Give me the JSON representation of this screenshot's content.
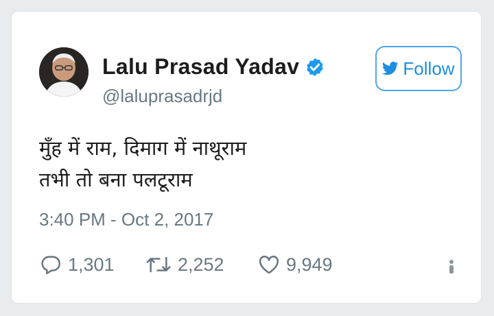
{
  "tweet": {
    "author_name": "Lalu Prasad Yadav",
    "handle": "@laluprasadrjd",
    "verified": true,
    "follow_label": "Follow",
    "text_lines": [
      "मुँह में राम, दिमाग में नाथूराम",
      "तभी तो बना पलटूराम"
    ],
    "timestamp": "3:40 PM - Oct 2, 2017",
    "replies": "1,301",
    "retweets": "2,252",
    "likes": "9,949"
  },
  "icons": {
    "verified": "verified-badge-icon",
    "follow": "twitter-bird-icon",
    "reply": "reply-icon",
    "retweet": "retweet-icon",
    "like": "heart-icon",
    "info": "info-icon"
  },
  "colors": {
    "accent": "#1d8ee0",
    "verified": "#1d9bf0",
    "muted_text": "#687882",
    "text": "#1c1c1c"
  }
}
